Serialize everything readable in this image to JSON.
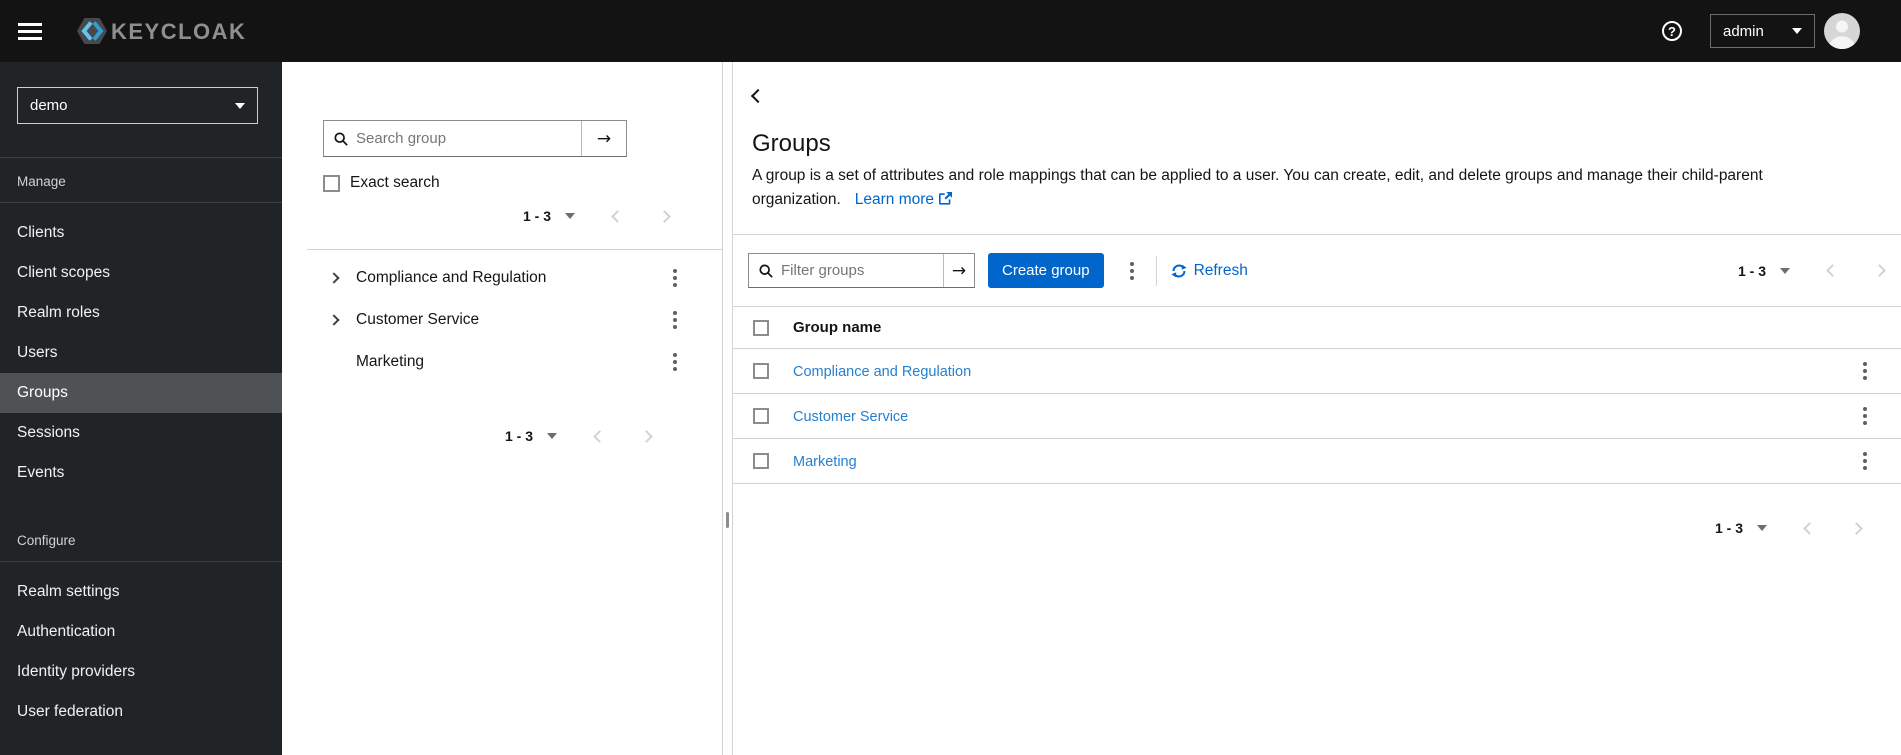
{
  "topbar": {
    "brand": "KEYCLOAK",
    "username": "admin"
  },
  "sidebar": {
    "realm": "demo",
    "selected_item": "Groups",
    "sections": [
      {
        "label": "Manage",
        "items": [
          "Clients",
          "Client scopes",
          "Realm roles",
          "Users",
          "Groups",
          "Sessions",
          "Events"
        ]
      },
      {
        "label": "Configure",
        "items": [
          "Realm settings",
          "Authentication",
          "Identity providers",
          "User federation"
        ]
      }
    ]
  },
  "tree_panel": {
    "search_placeholder": "Search group",
    "exact_search_label": "Exact search",
    "pagination_label": "1 - 3",
    "items": [
      {
        "label": "Compliance and Regulation",
        "expandable": true
      },
      {
        "label": "Customer Service",
        "expandable": true
      },
      {
        "label": "Marketing",
        "expandable": false
      }
    ]
  },
  "main": {
    "title": "Groups",
    "description": "A group is a set of attributes and role mappings that can be applied to a user. You can create, edit, and delete groups and manage their child-parent organization.",
    "learn_more_label": "Learn more",
    "toolbar": {
      "filter_placeholder": "Filter groups",
      "create_button_label": "Create group",
      "refresh_label": "Refresh",
      "pagination_label": "1 - 3"
    },
    "table": {
      "column_header": "Group name",
      "rows": [
        {
          "name": "Compliance and Regulation"
        },
        {
          "name": "Customer Service"
        },
        {
          "name": "Marketing"
        }
      ]
    },
    "pagination_label": "1 - 3"
  },
  "colors": {
    "primary_button": "#0066cc",
    "link": "#0066cc",
    "table_link": "#2680d0",
    "masthead_bg": "#131314",
    "sidebar_bg": "#212427",
    "selected_nav_bg": "#4f5255"
  }
}
